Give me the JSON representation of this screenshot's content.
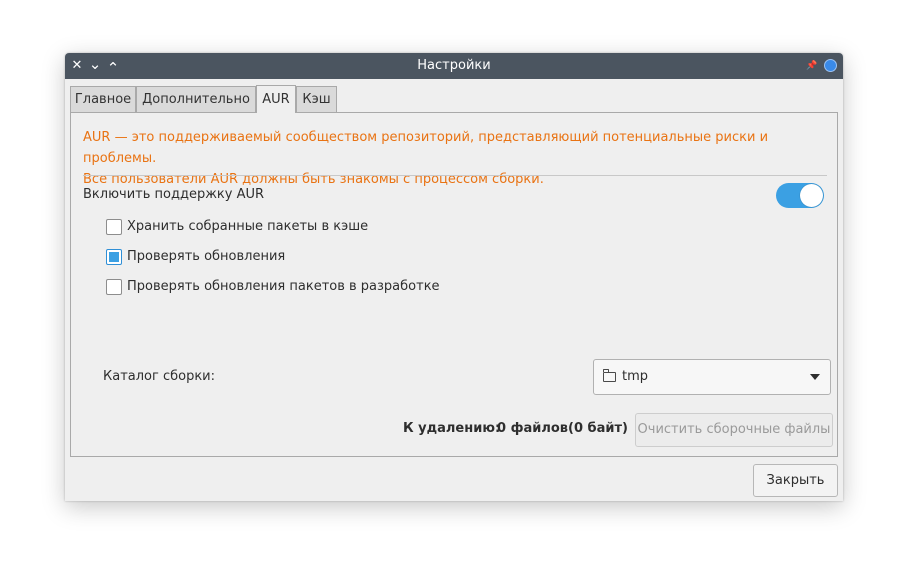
{
  "window": {
    "title": "Настройки",
    "titlebar_buttons": {
      "close": "✕",
      "minimize": "⌄",
      "maximize": "⌃",
      "pin": "📌"
    }
  },
  "tabs": [
    {
      "label": "Главное",
      "active": false
    },
    {
      "label": "Дополнительно",
      "active": false
    },
    {
      "label": "AUR",
      "active": true
    },
    {
      "label": "Кэш",
      "active": false
    }
  ],
  "aur": {
    "notice_line1": "AUR — это поддерживаемый сообществом репозиторий, представляющий потенциальные риски и проблемы.",
    "notice_line2": "Все пользователи AUR должны быть знакомы с процессом сборки.",
    "enable_label": "Включить поддержку AUR",
    "enable_state": true,
    "options": [
      {
        "label": "Хранить собранные пакеты в кэше",
        "checked": false
      },
      {
        "label": "Проверять обновления",
        "checked": true
      },
      {
        "label": "Проверять обновления пакетов в разработке",
        "checked": false
      }
    ],
    "build_dir_label": "Каталог сборки:",
    "build_dir_value": "tmp",
    "summary_label": "К удалению:",
    "summary_files": "0 файлов",
    "summary_size": "(0 байт)",
    "clean_button": "Очистить сборочные файлы"
  },
  "footer": {
    "close_button": "Закрыть"
  },
  "colors": {
    "titlebar": "#4b5560",
    "accent": "#3ba0e3",
    "warning_text": "#e97313"
  }
}
